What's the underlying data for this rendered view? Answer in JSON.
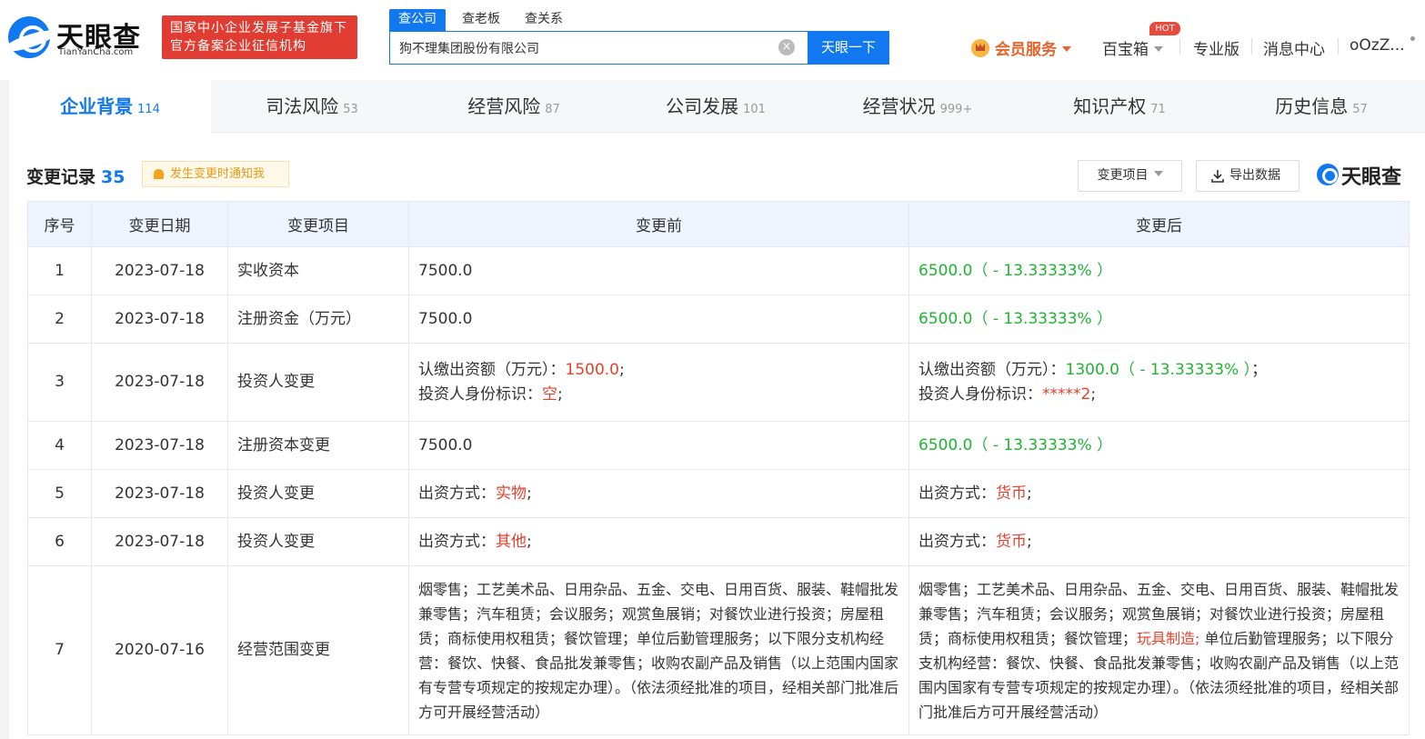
{
  "header": {
    "logo_name": "天眼查",
    "logo_sub": "TianYanCha.com",
    "gov_badge_line1": "国家中小企业发展子基金旗下",
    "gov_badge_line2": "官方备案企业征信机构",
    "search_tabs": [
      "查公司",
      "查老板",
      "查关系"
    ],
    "search_value": "狗不理集团股份有限公司",
    "search_button": "天眼一下",
    "vip_label": "会员服务",
    "treasure_label": "百宝箱",
    "hot_badge": "HOT",
    "pro_label": "专业版",
    "message_label": "消息中心",
    "user_label": "oOzZ..."
  },
  "tabs": [
    {
      "label": "企业背景",
      "count": "114"
    },
    {
      "label": "司法风险",
      "count": "53"
    },
    {
      "label": "经营风险",
      "count": "87"
    },
    {
      "label": "公司发展",
      "count": "101"
    },
    {
      "label": "经营状况",
      "count": "999+"
    },
    {
      "label": "知识产权",
      "count": "71"
    },
    {
      "label": "历史信息",
      "count": "57"
    }
  ],
  "section": {
    "title": "变更记录",
    "count": "35",
    "notify_label": "发生变更时通知我",
    "filter_label": "变更项目",
    "export_label": "导出数据",
    "watermark": "天眼查"
  },
  "table": {
    "headers": [
      "序号",
      "变更日期",
      "变更项目",
      "变更前",
      "变更后"
    ],
    "rows": [
      {
        "no": "1",
        "date": "2023-07-18",
        "item": "实收资本",
        "before": "7500.0",
        "after": "6500.0（ - 13.33333% ）"
      },
      {
        "no": "2",
        "date": "2023-07-18",
        "item": "注册资金（万元）",
        "before": "7500.0",
        "after": "6500.0（ - 13.33333% ）"
      },
      {
        "no": "3",
        "date": "2023-07-18",
        "item": "投资人变更",
        "before_l1_label": "认缴出资额（万元）：",
        "before_l1_value": "1500.0",
        "before_l1_suffix": ";",
        "before_l2_label": "投资人身份标识：",
        "before_l2_value": "空",
        "before_l2_suffix": ";",
        "after_l1_label": "认缴出资额（万元）：",
        "after_l1_value": "1300.0（ - 13.33333% ）",
        "after_l1_suffix": "；",
        "after_l2_label": "投资人身份标识：",
        "after_l2_value": "*****2",
        "after_l2_suffix": ";"
      },
      {
        "no": "4",
        "date": "2023-07-18",
        "item": "注册资本变更",
        "before": "7500.0",
        "after": "6500.0（ - 13.33333% ）"
      },
      {
        "no": "5",
        "date": "2023-07-18",
        "item": "投资人变更",
        "before_label": "出资方式：",
        "before_value": "实物",
        "before_suffix": ";",
        "after_label": "出资方式：",
        "after_value": "货币",
        "after_suffix": ";"
      },
      {
        "no": "6",
        "date": "2023-07-18",
        "item": "投资人变更",
        "before_label": "出资方式：",
        "before_value": "其他",
        "before_suffix": ";",
        "after_label": "出资方式：",
        "after_value": "货币",
        "after_suffix": ";"
      },
      {
        "no": "7",
        "date": "2020-07-16",
        "item": "经营范围变更",
        "before": "烟零售；工艺美术品、日用杂品、五金、交电、日用百货、服装、鞋帽批发兼零售；汽车租赁；会议服务；观赏鱼展销；对餐饮业进行投资；房屋租赁；商标使用权租赁；餐饮管理；单位后勤管理服务；以下限分支机构经营：餐饮、快餐、食品批发兼零售；收购农副产品及销售（以上范围内国家有专营专项规定的按规定办理）。（依法须经批准的项目，经相关部门批准后方可开展经营活动）",
        "after_part1": "烟零售；工艺美术品、日用杂品、五金、交电、日用百货、服装、鞋帽批发兼零售；汽车租赁；会议服务；观赏鱼展销；对餐饮业进行投资；房屋租赁；商标使用权租赁；餐饮管理；",
        "after_highlight": "玩具制造;",
        "after_part2": " 单位后勤管理服务；以下限分支机构经营：餐饮、快餐、食品批发兼零售；收购农副产品及销售（以上范围内国家有专营专项规定的按规定办理）。（依法须经批准的项目，经相关部门批准后方可开展经营活动）"
      }
    ]
  },
  "colors": {
    "brand": "#1178f0",
    "increase_red": "#e6412c",
    "decrease_green": "#1fb532",
    "vip_orange": "#e8622a"
  }
}
